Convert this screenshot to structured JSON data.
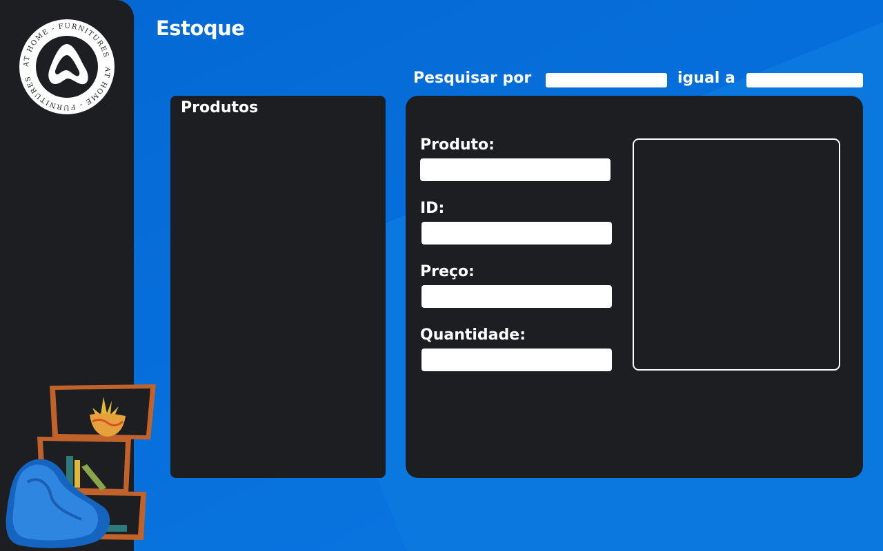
{
  "app": {
    "title": "Estoque",
    "logo_text": "AT HOME - FURNITURES"
  },
  "search": {
    "label_by": "Pesquisar por",
    "label_equal": "igual a",
    "field_value": "",
    "query_value": ""
  },
  "products": {
    "title": "Produtos",
    "items": []
  },
  "details": {
    "product_label": "Produto:",
    "product_value": "",
    "id_label": "ID:",
    "id_value": "",
    "price_label": "Preço:",
    "price_value": "",
    "quantity_label": "Quantidade:",
    "quantity_value": ""
  },
  "colors": {
    "background": "#0a6fd6",
    "panel": "#1c1e21",
    "accent_white": "#ffffff"
  },
  "icons": {
    "logo": "brand-logo-icon",
    "decoration": "shelf-and-beanbag-illustration"
  }
}
